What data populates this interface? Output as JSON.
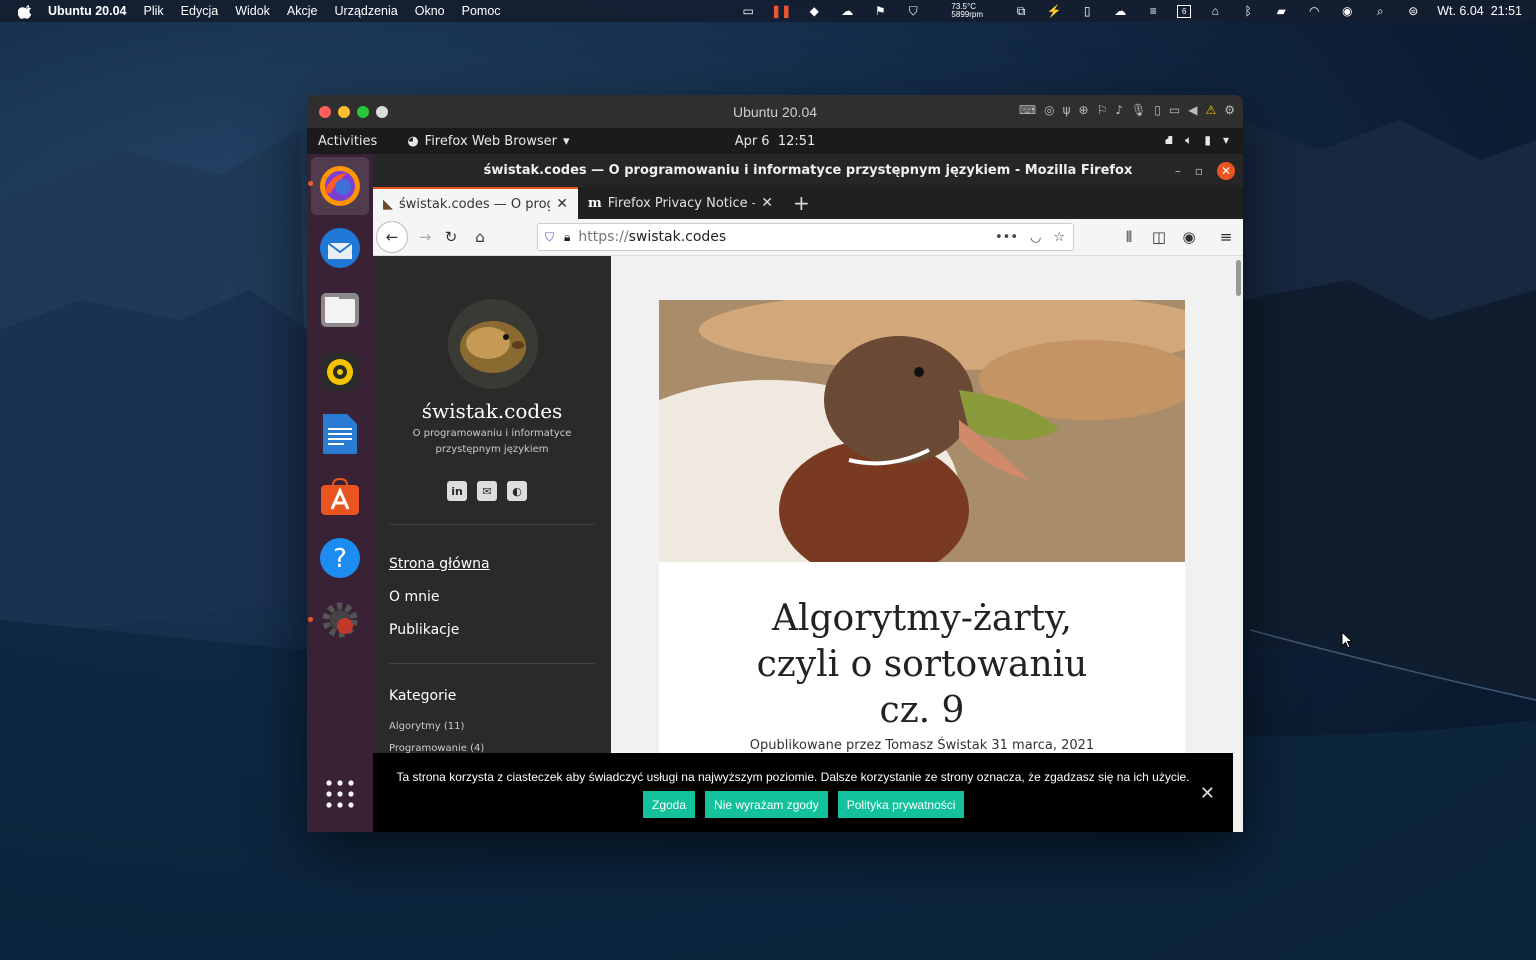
{
  "mac_menu": {
    "app_name": "Ubuntu 20.04",
    "items": [
      "Plik",
      "Edycja",
      "Widok",
      "Akcje",
      "Urządzenia",
      "Okno",
      "Pomoc"
    ],
    "temp": "73.5°C",
    "rpm": "5899rpm",
    "calendar_day": "6",
    "datetime": "Wt. 6.04  21:51"
  },
  "vm": {
    "title": "Ubuntu 20.04"
  },
  "gnome": {
    "activities": "Activities",
    "app_menu": "Firefox Web Browser",
    "clock": "Apr 6  12:51"
  },
  "firefox": {
    "window_title": "świstak.codes — O programowaniu i informatyce przystępnym językiem - Mozilla Firefox",
    "tabs": [
      {
        "label": "świstak.codes — O programowaniu i informatyce przystępnym językiem"
      },
      {
        "label": "Firefox Privacy Notice — Mozilla"
      }
    ],
    "url_prefix": "https://",
    "url_host": "swistak.codes",
    "more_actions": "•••"
  },
  "site": {
    "title": "świstak.codes",
    "description": "O programowaniu i informatyce przystępnym językiem",
    "nav": [
      "Strona główna",
      "O mnie",
      "Publikacje"
    ],
    "categories_heading": "Kategorie",
    "categories": [
      "Algorytmy (11)",
      "Programowanie (4)"
    ]
  },
  "post": {
    "title": "Algorytmy-żarty, czyli o sortowaniu cz. 9",
    "meta": "Opublikowane przez Tomasz Świstak 31 marca, 2021"
  },
  "cookie": {
    "message": "Ta strona korzysta z ciasteczek aby świadczyć usługi na najwyższym poziomie. Dalsze korzystanie ze strony oznacza, że zgadzasz się na ich użycie.",
    "accept": "Zgoda",
    "reject": "Nie wyrażam zgody",
    "policy": "Polityka prywatności",
    "button_color": "#13c29a"
  },
  "colors": {
    "ubuntu_orange": "#e95420",
    "dock_bg": "#3a2236"
  }
}
